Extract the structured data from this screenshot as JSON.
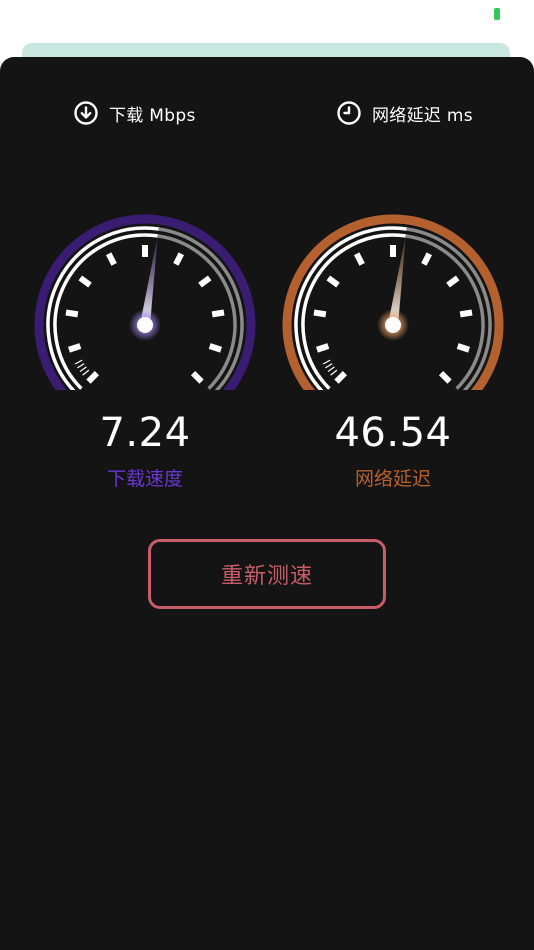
{
  "status_bar": {
    "battery_color": "#34c759"
  },
  "metrics": {
    "download": {
      "icon": "download-circle-icon",
      "header_label": "下载 Mbps",
      "value": "7.24",
      "value_numeric": 7.24,
      "needle_fraction": 0.53,
      "caption": "下载速度",
      "accent_color": "#3a1c73",
      "caption_color": "#6a36d1",
      "glow_color": "#9a7fe6"
    },
    "latency": {
      "icon": "clock-icon",
      "header_label": "网络延迟 ms",
      "value": "46.54",
      "value_numeric": 46.54,
      "needle_fraction": 0.53,
      "caption": "网络延迟",
      "accent_color": "#b4602f",
      "caption_color": "#b6602e",
      "glow_color": "#e39c65"
    }
  },
  "actions": {
    "retest_label": "重新测速",
    "retest_color": "#c65d68"
  }
}
